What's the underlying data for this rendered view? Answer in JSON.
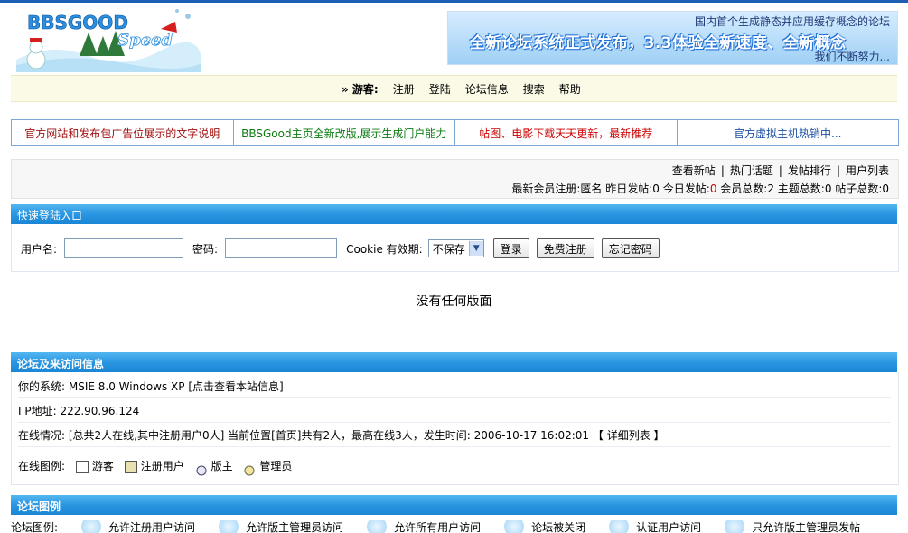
{
  "header": {
    "logo_text": "BBSGOOD",
    "logo_sub": "Speed",
    "banner_line1": "国内首个生成静态并应用缓存概念的论坛",
    "banner_line2": "全新论坛系统正式发布，3.3体验全新速度、全新概念",
    "banner_line3": "我们不断努力..."
  },
  "nav": {
    "guest_label": "» 游客:",
    "links": [
      "注册",
      "登陆",
      "论坛信息",
      "搜索",
      "帮助"
    ]
  },
  "ads": [
    {
      "text": "官方网站和发布包广告位展示的文字说明",
      "color": "#a11010"
    },
    {
      "text": "BBSGood主页全新改版,展示生成门户能力",
      "color": "#0b7a12"
    },
    {
      "text": "帖图、电影下载天天更新，最新推荐",
      "color": "#cc0000"
    },
    {
      "text": "官方虚拟主机热销中...",
      "color": "#1c4fa3"
    }
  ],
  "stats": {
    "links": [
      "查看新帖",
      "热门话题",
      "发帖排行",
      "用户列表"
    ],
    "newest_member": "最新会员注册:匿名",
    "yesterday": "昨日发帖:0",
    "today_label": "今日发帖:",
    "today_value": "0",
    "members": "会员总数:2",
    "topics": "主题总数:0",
    "posts": "帖子总数:0"
  },
  "login": {
    "title": "快速登陆入口",
    "username_label": "用户名:",
    "password_label": "密码:",
    "cookie_label": "Cookie 有效期:",
    "cookie_value": "不保存",
    "login_button": "登录",
    "register_button": "免费注册",
    "forgot_button": "忘记密码"
  },
  "main": {
    "empty_message": "没有任何版面"
  },
  "info": {
    "title": "论坛及来访问信息",
    "system": "你的系统: MSIE 8.0 Windows XP [点击查看本站信息]",
    "ip": "I P地址: 222.90.96.124",
    "online": "在线情况: [总共2人在线,其中注册用户0人] 当前位置[首页]共有2人，最高在线3人，发生时间: 2006-10-17 16:02:01 【 详细列表 】",
    "legend_label": "在线图例:",
    "legend_guest": "游客",
    "legend_registered": "注册用户",
    "legend_moderator": "版主",
    "legend_admin": "管理员"
  },
  "legend": {
    "title": "论坛图例",
    "label": "论坛图例:",
    "items": [
      "允许注册用户访问",
      "允许版主管理员访问",
      "允许所有用户访问",
      "论坛被关闭",
      "认证用户访问",
      "只允许版主管理员发帖"
    ]
  }
}
